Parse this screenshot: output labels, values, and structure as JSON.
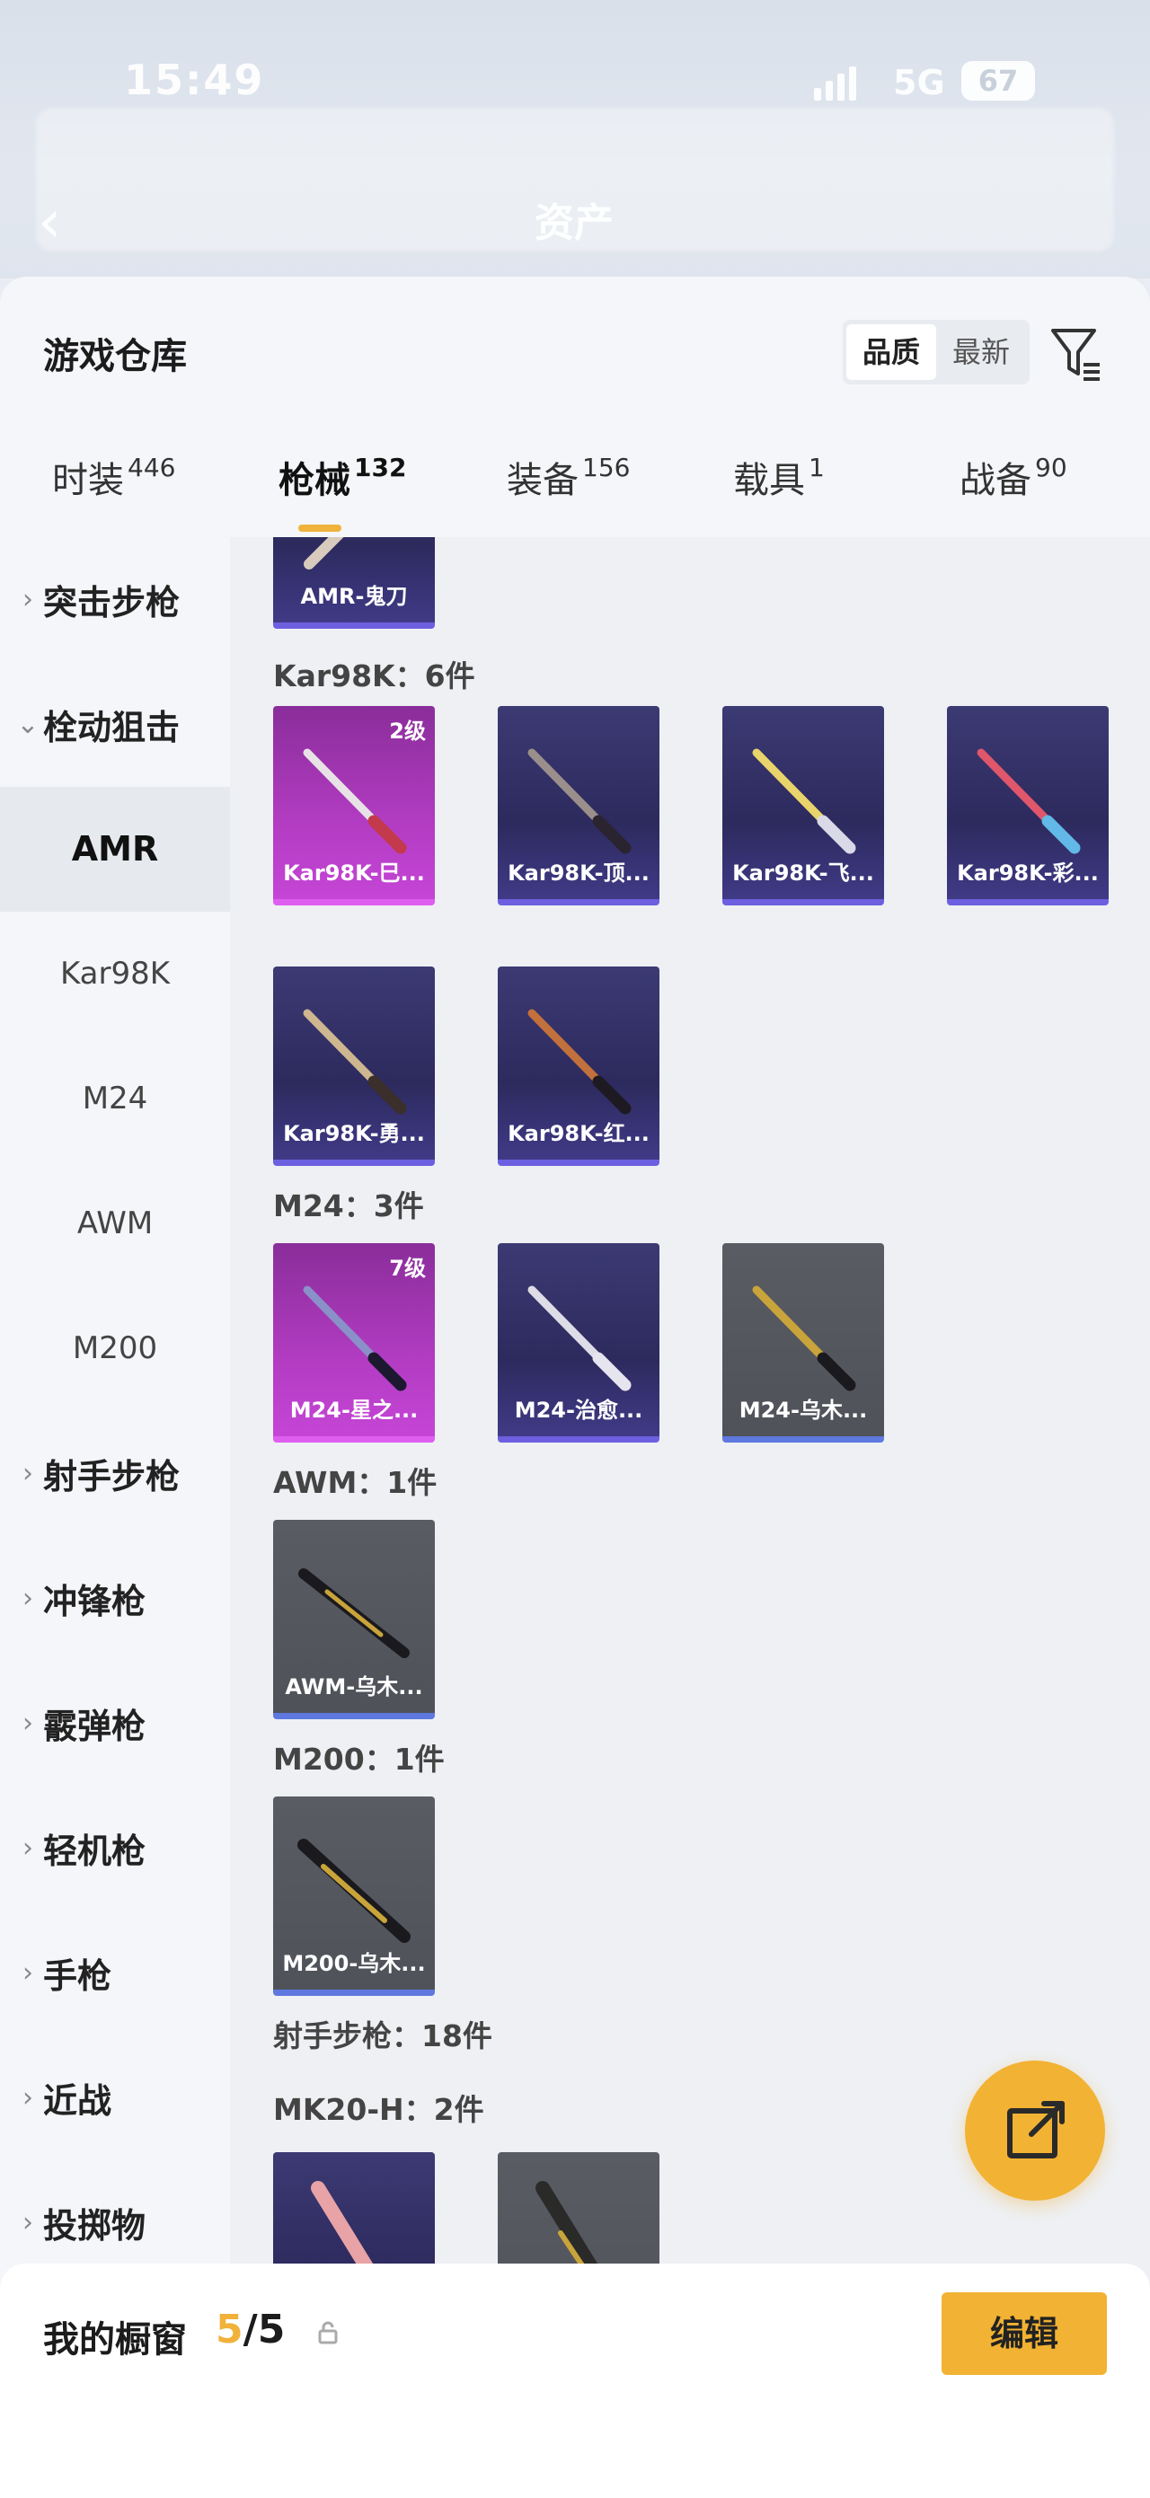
{
  "status_bar": {
    "time": "15:49",
    "network": "5G",
    "battery": "67"
  },
  "header": {
    "title": "资产"
  },
  "sheet": {
    "title": "游戏仓库",
    "sort_options": [
      "品质",
      "最新"
    ],
    "active_sort": "品质"
  },
  "tabs": [
    {
      "label": "时装",
      "count": "446"
    },
    {
      "label": "枪械",
      "count": "132"
    },
    {
      "label": "装备",
      "count": "156"
    },
    {
      "label": "载具",
      "count": "1"
    },
    {
      "label": "战备",
      "count": "90"
    }
  ],
  "sidebar": {
    "items": [
      {
        "label": "突击步枪",
        "expanded": false
      },
      {
        "label": "栓动狙击",
        "expanded": true
      },
      {
        "label": "AMR",
        "sub": true,
        "active": true
      },
      {
        "label": "Kar98K",
        "sub": true
      },
      {
        "label": "M24",
        "sub": true
      },
      {
        "label": "AWM",
        "sub": true
      },
      {
        "label": "M200",
        "sub": true
      },
      {
        "label": "射手步枪",
        "expanded": false
      },
      {
        "label": "冲锋枪",
        "expanded": false
      },
      {
        "label": "霰弹枪",
        "expanded": false
      },
      {
        "label": "轻机枪",
        "expanded": false
      },
      {
        "label": "手枪",
        "expanded": false
      },
      {
        "label": "近战",
        "expanded": false
      },
      {
        "label": "投掷物",
        "expanded": false
      }
    ]
  },
  "content": {
    "amr_card": {
      "name": "AMR-鬼刀"
    },
    "kar98k": {
      "header": "Kar98K：6件",
      "items": [
        {
          "name": "Kar98K-巳...",
          "level": "2级",
          "rarity": "pink"
        },
        {
          "name": "Kar98K-顶...",
          "rarity": "purple"
        },
        {
          "name": "Kar98K-飞...",
          "rarity": "purple"
        },
        {
          "name": "Kar98K-彩...",
          "rarity": "purple"
        },
        {
          "name": "Kar98K-勇...",
          "rarity": "purple"
        },
        {
          "name": "Kar98K-红...",
          "rarity": "purple"
        }
      ]
    },
    "m24": {
      "header": "M24：3件",
      "items": [
        {
          "name": "M24-星之...",
          "level": "7级",
          "rarity": "pink"
        },
        {
          "name": "M24-治愈...",
          "rarity": "purple"
        },
        {
          "name": "M24-乌木...",
          "rarity": "gray"
        }
      ]
    },
    "awm": {
      "header": "AWM：1件",
      "items": [
        {
          "name": "AWM-乌木...",
          "rarity": "gray"
        }
      ]
    },
    "m200": {
      "header": "M200：1件",
      "items": [
        {
          "name": "M200-乌木...",
          "rarity": "gray"
        }
      ]
    },
    "dmr_header": "射手步枪：18件",
    "mk20": {
      "header": "MK20-H：2件"
    }
  },
  "showcase": {
    "label": "我的橱窗",
    "current": "5",
    "total": "/5",
    "edit_label": "编辑"
  },
  "colors": {
    "accent": "#f2b233",
    "purple": "#3c3a73",
    "pink": "#b23cc2",
    "gray": "#55575f"
  }
}
